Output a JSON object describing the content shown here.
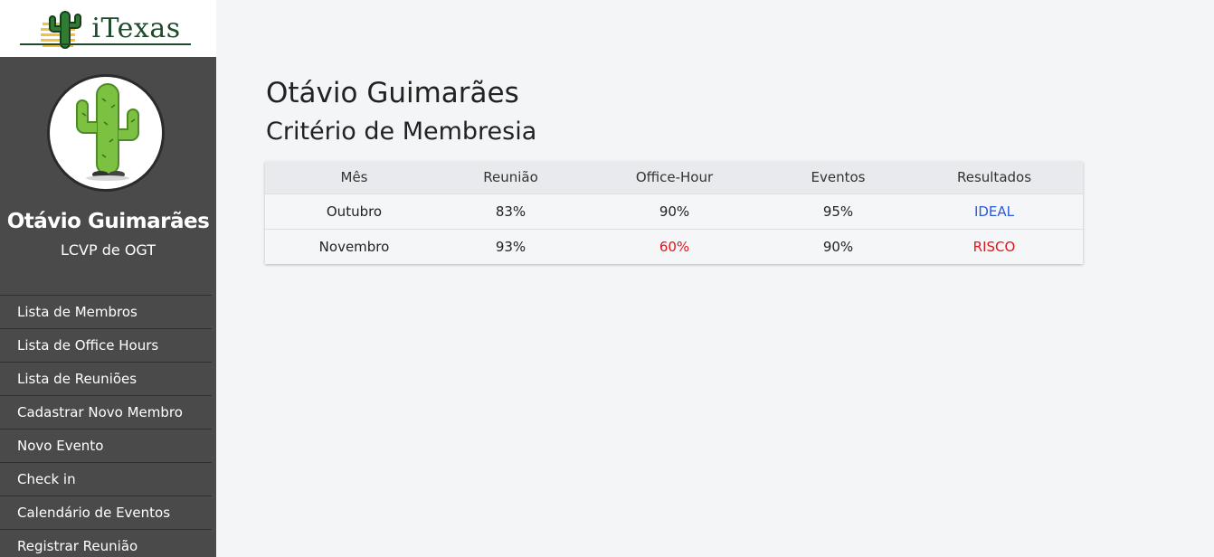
{
  "app": {
    "logo_text": "iTexas"
  },
  "sidebar": {
    "user_name": "Otávio Guimarães",
    "user_role": "LCVP de OGT",
    "items": [
      {
        "label": "Lista de Membros"
      },
      {
        "label": "Lista de Office Hours"
      },
      {
        "label": "Lista de Reuniões"
      },
      {
        "label": "Cadastrar Novo Membro"
      },
      {
        "label": "Novo Evento"
      },
      {
        "label": "Check in"
      },
      {
        "label": "Calendário de Eventos"
      },
      {
        "label": "Registrar Reunião"
      }
    ]
  },
  "main": {
    "title": "Otávio Guimarães",
    "subtitle": "Critério de Membresia",
    "table": {
      "headers": [
        "Mês",
        "Reunião",
        "Office-Hour",
        "Eventos",
        "Resultados"
      ],
      "rows": [
        {
          "mes": "Outubro",
          "reuniao": "83%",
          "office_hour": "90%",
          "eventos": "95%",
          "resultado": "IDEAL"
        },
        {
          "mes": "Novembro",
          "reuniao": "93%",
          "office_hour": "60%",
          "eventos": "90%",
          "resultado": "RISCO"
        }
      ]
    }
  },
  "colors": {
    "sidebar_bg": "#4a4a4a",
    "ideal": "#2b5bd7",
    "risk": "#e0141c",
    "logo_green": "#1f4a2b"
  }
}
